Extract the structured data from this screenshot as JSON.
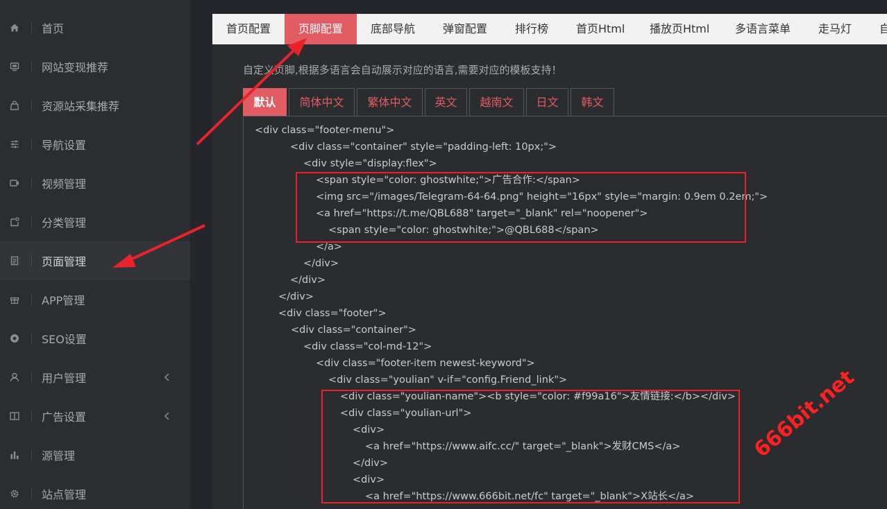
{
  "sidebar": {
    "items": [
      {
        "label": "首页",
        "icon": "home-icon"
      },
      {
        "label": "网站变现推荐",
        "icon": "monitor-icon"
      },
      {
        "label": "资源站采集推荐",
        "icon": "bag-icon"
      },
      {
        "label": "导航设置",
        "icon": "sliders-icon"
      },
      {
        "label": "视频管理",
        "icon": "video-icon"
      },
      {
        "label": "分类管理",
        "icon": "folder-icon"
      },
      {
        "label": "页面管理",
        "icon": "document-icon"
      },
      {
        "label": "APP管理",
        "icon": "gift-icon"
      },
      {
        "label": "SEO设置",
        "icon": "chrome-icon"
      },
      {
        "label": "用户管理",
        "icon": "user-icon"
      },
      {
        "label": "广告设置",
        "icon": "book-icon"
      },
      {
        "label": "源管理",
        "icon": "bar-chart-icon"
      },
      {
        "label": "站点管理",
        "icon": "gear-icon"
      }
    ]
  },
  "topnav": {
    "tabs": [
      "首页配置",
      "页脚配置",
      "底部导航",
      "弹窗配置",
      "排行榜",
      "首页Html",
      "播放页Html",
      "多语言菜单",
      "走马灯",
      "自"
    ]
  },
  "description": "自定义页脚,根据多语言会自动展示对应的语言,需要对应的模板支持！",
  "lang_tabs": [
    "默认",
    "简体中文",
    "繁体中文",
    "英文",
    "越南文",
    "日文",
    "韩文"
  ],
  "code_lines": [
    "<div class=\"footer-menu\">",
    "<div class=\"container\" style=\"padding-left: 10px;\">",
    "<div style=\"display:flex\">",
    "<span style=\"color: ghostwhite;\">广告合作:</span>",
    "<img src=\"/images/Telegram-64-64.png\" height=\"16px\" style=\"margin: 0.9em 0.2em;\">",
    "<a href=\"https://t.me/QBL688\" target=\"_blank\" rel=\"noopener\">",
    "<span style=\"color: ghostwhite;\">@QBL688</span>",
    "</a>",
    "</div>",
    "</div>",
    "</div>",
    "<div class=\"footer\">",
    "<div class=\"container\">",
    "<div class=\"col-md-12\">",
    "<div class=\"footer-item newest-keyword\">",
    "<div class=\"youlian\" v-if=\"config.Friend_link\">",
    "<div class=\"youlian-name\"><b style=\"color: #f99a16\">友情链接:</b></div>",
    "<div class=\"youlian-url\">",
    "<div>",
    "<a href=\"https://www.aifc.cc/\" target=\"_blank\">发财CMS</a>",
    "</div>",
    "<div>",
    "<a href=\"https://www.666bit.net/fc\" target=\"_blank\">X站长</a>"
  ],
  "watermark": "666bit.net",
  "colors": {
    "accent": "#e25c64",
    "annotation_red": "#e8242b"
  }
}
